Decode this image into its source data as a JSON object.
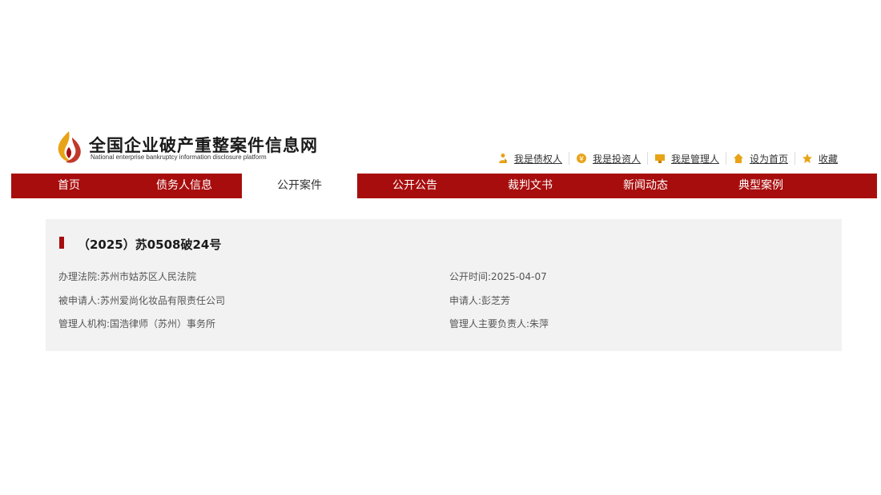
{
  "site": {
    "title": "全国企业破产重整案件信息网",
    "subtitle": "National enterprise bankruptcy  information disclosure platform"
  },
  "quick_links": [
    {
      "label": "我是债权人",
      "icon": "creditor-icon"
    },
    {
      "label": "我是投资人",
      "icon": "investor-icon"
    },
    {
      "label": "我是管理人",
      "icon": "manager-icon"
    },
    {
      "label": "设为首页",
      "icon": "home-icon"
    },
    {
      "label": "收藏",
      "icon": "star-icon"
    }
  ],
  "nav": {
    "items": [
      "首页",
      "债务人信息",
      "公开案件",
      "公开公告",
      "裁判文书",
      "新闻动态",
      "典型案例"
    ],
    "active": "公开案件"
  },
  "case": {
    "title": "（2025）苏0508破24号",
    "court_label": "办理法院:",
    "court": "苏州市姑苏区人民法院",
    "date_label": "公开时间:",
    "date": "2025-04-07",
    "respondent_label": "被申请人:",
    "respondent": "苏州爱尚化妆品有限责任公司",
    "applicant_label": "申请人:",
    "applicant": "彭芝芳",
    "admin_label": "管理人机构:",
    "admin": "国浩律师（苏州）事务所",
    "admin_head_label": "管理人主要负责人:",
    "admin_head": "朱萍"
  },
  "colors": {
    "brand_red": "#a80d0d",
    "card_bg": "#f2f2f2",
    "icon_gold": "#e8a317"
  }
}
